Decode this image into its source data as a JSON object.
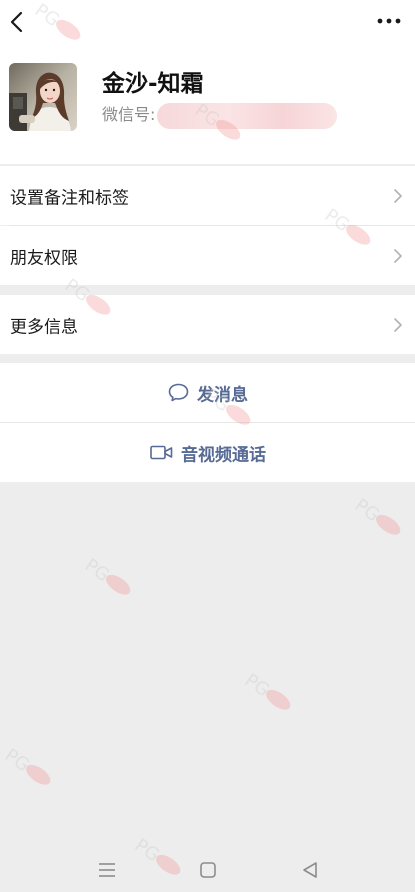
{
  "header": {
    "back_icon": "chevron-left-icon",
    "more_icon": "more-dots-icon"
  },
  "profile": {
    "nickname": "金沙-知霜",
    "wechat_id_label": "微信号:",
    "wechat_id_value": ""
  },
  "menu": {
    "remarks_tags": "设置备注和标签",
    "friend_permissions": "朋友权限",
    "more_info": "更多信息"
  },
  "actions": {
    "send_message": "发消息",
    "video_call": "音视频通话",
    "accent_color": "#576b95"
  },
  "system_nav": {
    "menu_icon": "menu-lines-icon",
    "home_icon": "home-square-icon",
    "back_icon": "back-triangle-icon"
  }
}
